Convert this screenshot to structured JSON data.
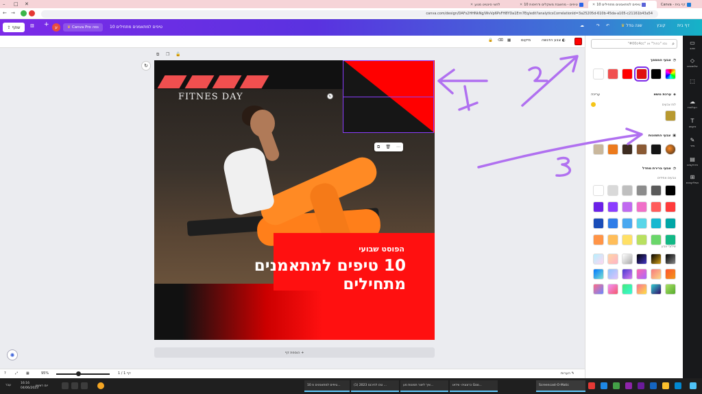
{
  "browser": {
    "tabs": [
      {
        "label": "Canva - דף בית"
      },
      {
        "label": "10 טיפים למתאמנים מתחילים"
      },
      {
        "label": "10 טיפים - מחשבת משקלים ודחיסות"
      },
      {
        "label": "לחצי סינטיט מנוע"
      }
    ],
    "url": "canva.com/design/DAFs2HHNkNg/WvVp6PsFH8YDa1Ern7Eq/edit?analyticsCorrelationId=3a25205d-610b-45da-a105-c21161b43a54"
  },
  "header": {
    "home_label": "דף בית",
    "file_label": "קובץ",
    "resize_label": "שנה גודל",
    "doc_title": "10 טיפים למתאמנים מתחילים",
    "try_pro": "Canva Pro נסה",
    "avatar_letter": "ע",
    "share_label": "שתף",
    "colors": {
      "grad_start": "#7d2ae8",
      "grad_end": "#15b3c7"
    }
  },
  "toolbar": {
    "color_label": "צבע הדגשה",
    "position_label": "מיקום"
  },
  "panel": {
    "search_placeholder": "נסו \"כחול\" או \"#00c4cc\"",
    "doc_colors_title": "צבעי המסמך",
    "doc_colors": [
      "#ffffff",
      "#f04f4f",
      "#ff0000",
      "#e01010",
      "#000000"
    ],
    "theme_title": "ערכת נושא",
    "theme_edit": "עריכה",
    "theme_sub": "לוח צבעים",
    "theme_color": "#b89930",
    "photo_colors_title": "צבעי התמונות",
    "photo_colors": [
      "#c9b79c",
      "#ec7a1c",
      "#3d2c20",
      "#8a5a34",
      "#141414"
    ],
    "default_title": "צבעי ברירת מחדל",
    "solid_title": "צבעים אחידים",
    "solid_colors": [
      [
        "#ffffff",
        "#d9d9d9",
        "#bfbfbf",
        "#8c8c8c",
        "#5a5a5a",
        "#000000"
      ],
      [
        "#6b21e8",
        "#8b3dff",
        "#c06af0",
        "#f070c8",
        "#ff5c5c",
        "#ff3b3b"
      ],
      [
        "#1a4db8",
        "#2f7de8",
        "#4aa8f0",
        "#58d6e8",
        "#16b8d0",
        "#00a6a6"
      ],
      [
        "#ff9447",
        "#ffbd59",
        "#ffe066",
        "#b8e060",
        "#6ad66a",
        "#12b886"
      ]
    ],
    "gradient_title": "שילובי צבע",
    "gradients": [
      [
        "linear-gradient(135deg,#b5f0ff,#ffd6f0)",
        "linear-gradient(135deg,#ffd6a5,#ffb3c6)",
        "linear-gradient(135deg,#fff,#aaa)",
        "linear-gradient(135deg,#000,#4438c7)",
        "linear-gradient(135deg,#000,#d4a017)",
        "linear-gradient(135deg,#000,#888)"
      ],
      [
        "linear-gradient(135deg,#0077ff,#7de2d1)",
        "linear-gradient(135deg,#8ec5fc,#e0c3fc)",
        "linear-gradient(135deg,#4838d0,#d87cf0)",
        "linear-gradient(135deg,#f6a,#a6f)",
        "linear-gradient(135deg,#f7797d,#fbd786)",
        "linear-gradient(135deg,#ff512f,#f09819)"
      ],
      [
        "linear-gradient(135deg,#ff6a88,#6a88ff)",
        "linear-gradient(135deg,#f093fb,#f5576c)",
        "linear-gradient(135deg,#43e97b,#38f9d7)",
        "linear-gradient(135deg,#fa709a,#fee140)",
        "linear-gradient(135deg,#30cfd0,#330867)",
        "linear-gradient(135deg,#a8e063,#56ab2f)"
      ]
    ]
  },
  "iconbar": {
    "items": [
      "שאב",
      "אלמנטים",
      "העלאות",
      "טקסט",
      "ציור",
      "פרויקטים",
      "אפליקציות"
    ]
  },
  "design": {
    "fitness_title": "FITNES DAY",
    "weekly_label": "הפוסט שבועי",
    "headline": "10 טיפים למתאמנים מתחילים",
    "add_page": "+ הוספת דף",
    "colors": {
      "red": "#ff0000",
      "accent_bar": "#f04f4f"
    }
  },
  "statusbar": {
    "notes": "הערות",
    "page": "דף 1 / 1",
    "zoom": "95%"
  },
  "taskbar": {
    "apps": [
      "10 טיפים למתאמנים מ...",
      "(1) טכו להיכנס 2023 ...",
      "איך ליצור תמונות מע...",
      "כרונוגיה- ווידאו Goo...",
      "Screencast-O-Matic"
    ],
    "time": "16:16",
    "day": "יום ראשון",
    "date": "04/06/2023",
    "lang": "עבר"
  },
  "annotations": {
    "labels": [
      "1",
      "2",
      "3"
    ],
    "color": "#b070f0"
  }
}
